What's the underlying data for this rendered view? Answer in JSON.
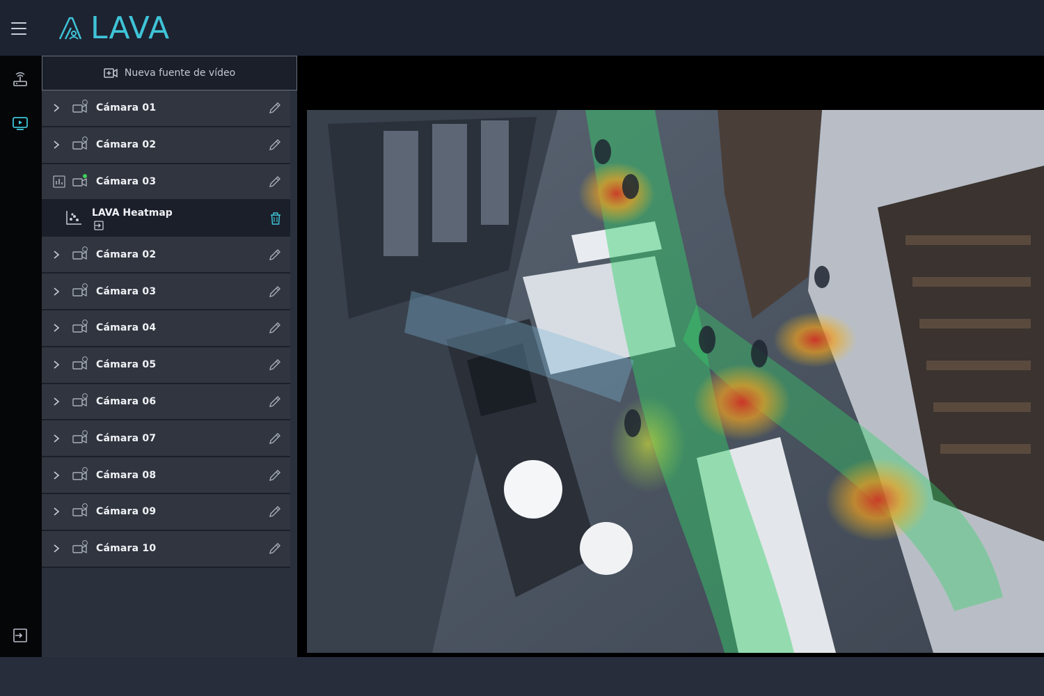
{
  "app": {
    "logo_text": "LAVA",
    "accent_color": "#3fc4d8"
  },
  "rail": {
    "items": [
      {
        "icon": "router-icon"
      },
      {
        "icon": "video-player-icon",
        "active": true
      },
      {
        "icon": "logout-icon"
      }
    ]
  },
  "sidebar": {
    "new_source_label": "Nueva fuente de vídeo",
    "cameras": [
      {
        "label": "Cámara 01",
        "status": "idle"
      },
      {
        "label": "Cámara 02",
        "status": "idle"
      },
      {
        "label": "Cámara 03",
        "status": "active",
        "expanded": true
      },
      {
        "label": "Cámara 02",
        "status": "idle"
      },
      {
        "label": "Cámara 03",
        "status": "idle"
      },
      {
        "label": "Cámara 04",
        "status": "idle"
      },
      {
        "label": "Cámara 05",
        "status": "idle"
      },
      {
        "label": "Cámara 06",
        "status": "idle"
      },
      {
        "label": "Cámara 07",
        "status": "idle"
      },
      {
        "label": "Cámara 08",
        "status": "idle"
      },
      {
        "label": "Cámara 09",
        "status": "idle"
      },
      {
        "label": "Cámara 10",
        "status": "idle"
      }
    ],
    "subitem": {
      "label": "LAVA Heatmap"
    }
  },
  "colors": {
    "status_active": "#3ecf5a",
    "trash": "#3fc4d8"
  }
}
